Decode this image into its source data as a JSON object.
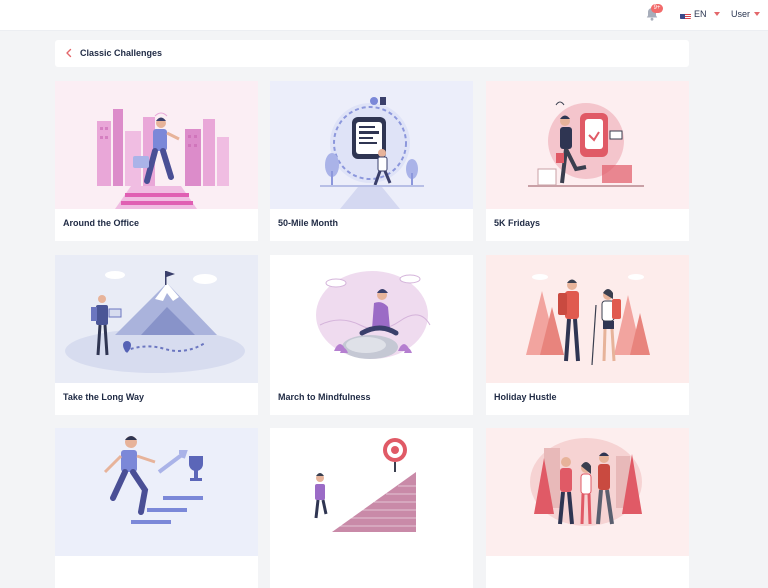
{
  "topbar": {
    "notification_count": "9+",
    "language": "EN",
    "user": "User",
    "icons": {
      "bell": "bell-icon",
      "flag": "us-flag-icon",
      "caret": "chevron-down-icon"
    },
    "accent": "#e3676b"
  },
  "header": {
    "title": "Classic Challenges",
    "back_icon": "chevron-left-icon"
  },
  "cards": [
    {
      "title": "Around the Office",
      "bg": "#fbeef4"
    },
    {
      "title": "50-Mile Month",
      "bg": "#eceefa"
    },
    {
      "title": "5K Fridays",
      "bg": "#fdeef0"
    },
    {
      "title": "Take the Long Way",
      "bg": "#e9ecf6"
    },
    {
      "title": "March to Mindfulness",
      "bg": "#ffffff"
    },
    {
      "title": "Holiday Hustle",
      "bg": "#fdeceb"
    },
    {
      "title": "",
      "bg": "#eceffa"
    },
    {
      "title": "",
      "bg": "#ffffff"
    },
    {
      "title": "",
      "bg": "#fdeeee"
    }
  ]
}
